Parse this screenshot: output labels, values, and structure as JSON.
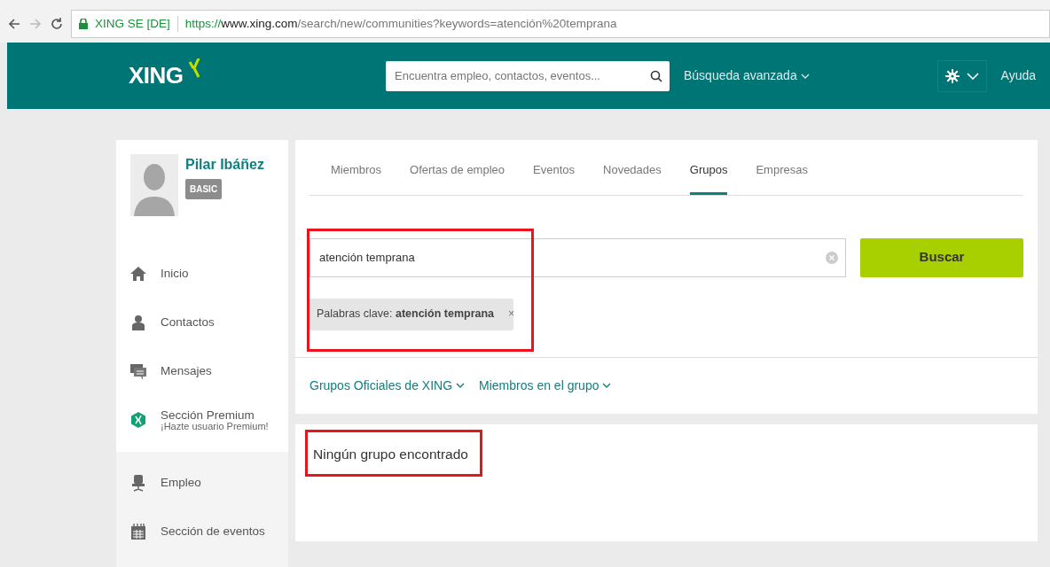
{
  "browser": {
    "site_label": "XING SE [DE]",
    "url_scheme": "https://",
    "url_host": "www.xing.com",
    "url_path": "/search/new/communities?keywords=atención%20temprana"
  },
  "header": {
    "logo": "XING",
    "search_placeholder": "Encuentra empleo, contactos, eventos...",
    "advanced_search": "Búsqueda avanzada",
    "help": "Ayuda"
  },
  "profile": {
    "name": "Pilar Ibáñez",
    "membership": "BASIC"
  },
  "sidebar": {
    "items": [
      {
        "kind": "home",
        "label": "Inicio"
      },
      {
        "kind": "contacts",
        "label": "Contactos"
      },
      {
        "kind": "messages",
        "label": "Mensajes"
      },
      {
        "kind": "premium",
        "label": "Sección Premium",
        "sublabel": "¡Hazte usuario Premium!"
      }
    ],
    "secondary_items": [
      {
        "kind": "jobs",
        "label": "Empleo"
      },
      {
        "kind": "events",
        "label": "Sección de eventos"
      }
    ]
  },
  "tabs": [
    {
      "label": "Miembros",
      "selected": false
    },
    {
      "label": "Ofertas de empleo",
      "selected": false
    },
    {
      "label": "Eventos",
      "selected": false
    },
    {
      "label": "Novedades",
      "selected": false
    },
    {
      "label": "Grupos",
      "selected": true
    },
    {
      "label": "Empresas",
      "selected": false
    }
  ],
  "search": {
    "value": "atención temprana",
    "button": "Buscar",
    "highlighted": true,
    "filter_tag": {
      "label": "Palabras clave:",
      "value": "atención temprana",
      "remove": "×"
    }
  },
  "filters": [
    "Grupos Oficiales de XING",
    "Miembros en el grupo"
  ],
  "results": {
    "message": "Ningún grupo encontrado",
    "highlighted": true
  }
}
